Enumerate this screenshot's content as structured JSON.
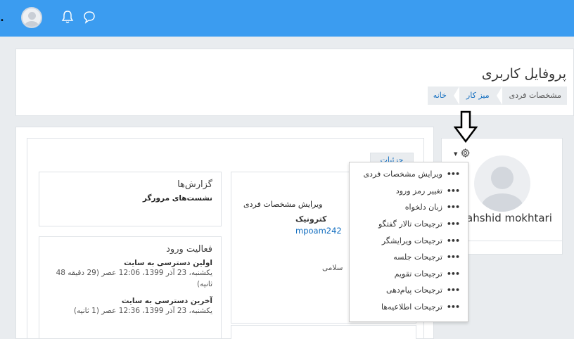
{
  "navbar": {
    "color": "#3b9cf0",
    "dot": "•",
    "icons": [
      "user-avatar",
      "bell-icon",
      "chat-icon"
    ]
  },
  "header": {
    "title": "پروفایل کاربری",
    "breadcrumb": [
      "خانه",
      "میز کار",
      "مشخصات فردی"
    ]
  },
  "tab": {
    "label": "جزئیات"
  },
  "reports": {
    "title": "گزارش‌ها",
    "link": "نشست‌های مرورگر"
  },
  "details": {
    "edit_link": "ویرایش مشخصات فردی",
    "email_label_fragment": "کترونیک",
    "email_fragment": "mpoam242",
    "country_fragment": "سلامی"
  },
  "activity": {
    "title": "فعالیت ورود",
    "first_label": "اولین دسترسی به سایت",
    "first_value": "یکشنبه، 23 آذر 1399، 12:06 عصر  (29 دقیقه 48 ثانیه)",
    "last_label": "آخرین دسترسی به سایت",
    "last_value": "یکشنبه، 23 آذر 1399، 12:36 عصر  (1 ثانیه)"
  },
  "profile": {
    "name": "ahshid mokhtari"
  },
  "menu": {
    "items": [
      "ویرایش مشخصات فردی",
      "تغییر رمز ورود",
      "زبان دلخواه",
      "ترجیحات تالار گفتگو",
      "ترجیحات ویرایشگر",
      "ترجیحات جلسه",
      "ترجیحات تقویم",
      "ترجیحات پیام‌دهی",
      "ترجیحات اطلاعیه‌ها"
    ],
    "bullet": "•••"
  }
}
